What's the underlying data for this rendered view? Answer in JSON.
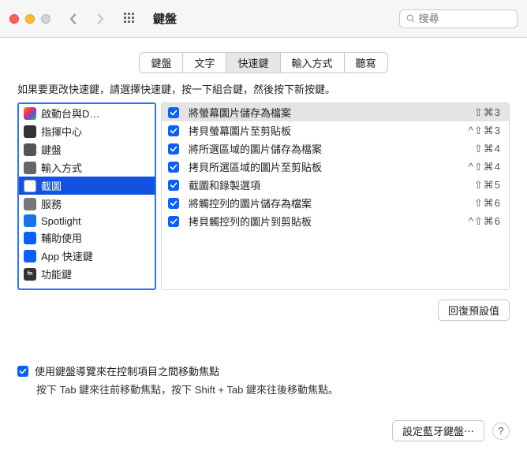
{
  "window": {
    "title": "鍵盤",
    "search_placeholder": "搜尋"
  },
  "tabs": [
    "鍵盤",
    "文字",
    "快速鍵",
    "輸入方式",
    "聽寫"
  ],
  "active_tab": 2,
  "instruction": "如果要更改快速鍵，請選擇快速鍵，按一下組合鍵，然後按下新按鍵。",
  "sidebar": {
    "selected": 4,
    "items": [
      {
        "label": "啟動台與D…",
        "icon": "launchpad-icon"
      },
      {
        "label": "指揮中心",
        "icon": "mission-control-icon"
      },
      {
        "label": "鍵盤",
        "icon": "keyboard-icon"
      },
      {
        "label": "輸入方式",
        "icon": "input-sources-icon"
      },
      {
        "label": "截圖",
        "icon": "screenshot-icon"
      },
      {
        "label": "服務",
        "icon": "services-icon"
      },
      {
        "label": "Spotlight",
        "icon": "spotlight-icon"
      },
      {
        "label": "輔助使用",
        "icon": "accessibility-icon"
      },
      {
        "label": "App 快速鍵",
        "icon": "app-shortcuts-icon"
      },
      {
        "label": "功能鍵",
        "icon": "fn-icon"
      }
    ]
  },
  "shortcuts": {
    "selected": 0,
    "rows": [
      {
        "checked": true,
        "label": "將螢幕圖片儲存為檔案",
        "keys": "⇧⌘3"
      },
      {
        "checked": true,
        "label": "拷貝螢幕圖片至剪貼板",
        "keys": "^⇧⌘3"
      },
      {
        "checked": true,
        "label": "將所選區域的圖片儲存為檔案",
        "keys": "⇧⌘4"
      },
      {
        "checked": true,
        "label": "拷貝所選區域的圖片至剪貼板",
        "keys": "^⇧⌘4"
      },
      {
        "checked": true,
        "label": "截圖和錄製選項",
        "keys": "⇧⌘5"
      },
      {
        "checked": true,
        "label": "將觸控列的圖片儲存為檔案",
        "keys": "⇧⌘6"
      },
      {
        "checked": true,
        "label": "拷貝觸控列的圖片到剪貼板",
        "keys": "^⇧⌘6"
      }
    ]
  },
  "buttons": {
    "restore_defaults": "回復預設值",
    "bluetooth": "設定藍牙鍵盤⋯",
    "help": "?"
  },
  "keyboard_nav": {
    "checked": true,
    "label": "使用鍵盤導覽來在控制項目之間移動焦點",
    "hint": "按下 Tab 鍵來往前移動焦點，按下 Shift + Tab 鍵來往後移動焦點。"
  }
}
